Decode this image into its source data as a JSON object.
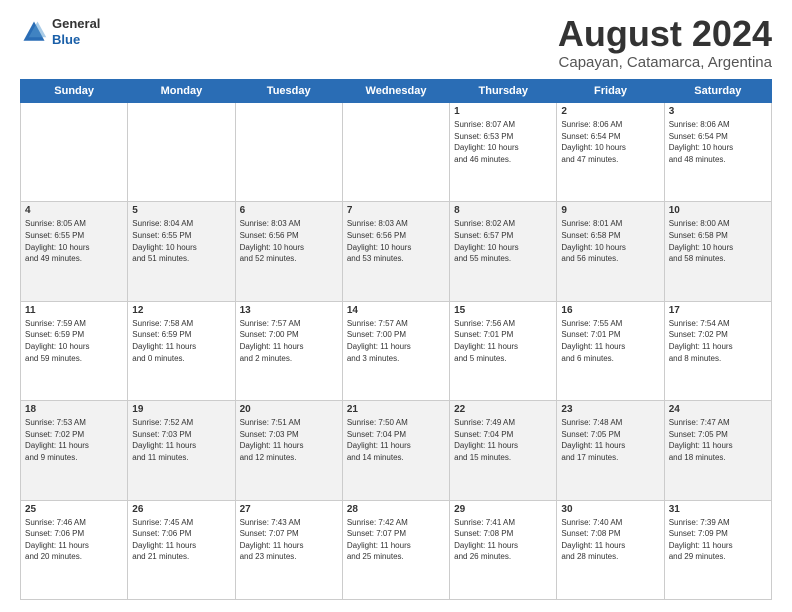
{
  "header": {
    "logo_general": "General",
    "logo_blue": "Blue",
    "title": "August 2024",
    "location": "Capayan, Catamarca, Argentina"
  },
  "days_of_week": [
    "Sunday",
    "Monday",
    "Tuesday",
    "Wednesday",
    "Thursday",
    "Friday",
    "Saturday"
  ],
  "weeks": [
    [
      {
        "day": "",
        "info": ""
      },
      {
        "day": "",
        "info": ""
      },
      {
        "day": "",
        "info": ""
      },
      {
        "day": "",
        "info": ""
      },
      {
        "day": "1",
        "info": "Sunrise: 8:07 AM\nSunset: 6:53 PM\nDaylight: 10 hours\nand 46 minutes."
      },
      {
        "day": "2",
        "info": "Sunrise: 8:06 AM\nSunset: 6:54 PM\nDaylight: 10 hours\nand 47 minutes."
      },
      {
        "day": "3",
        "info": "Sunrise: 8:06 AM\nSunset: 6:54 PM\nDaylight: 10 hours\nand 48 minutes."
      }
    ],
    [
      {
        "day": "4",
        "info": "Sunrise: 8:05 AM\nSunset: 6:55 PM\nDaylight: 10 hours\nand 49 minutes."
      },
      {
        "day": "5",
        "info": "Sunrise: 8:04 AM\nSunset: 6:55 PM\nDaylight: 10 hours\nand 51 minutes."
      },
      {
        "day": "6",
        "info": "Sunrise: 8:03 AM\nSunset: 6:56 PM\nDaylight: 10 hours\nand 52 minutes."
      },
      {
        "day": "7",
        "info": "Sunrise: 8:03 AM\nSunset: 6:56 PM\nDaylight: 10 hours\nand 53 minutes."
      },
      {
        "day": "8",
        "info": "Sunrise: 8:02 AM\nSunset: 6:57 PM\nDaylight: 10 hours\nand 55 minutes."
      },
      {
        "day": "9",
        "info": "Sunrise: 8:01 AM\nSunset: 6:58 PM\nDaylight: 10 hours\nand 56 minutes."
      },
      {
        "day": "10",
        "info": "Sunrise: 8:00 AM\nSunset: 6:58 PM\nDaylight: 10 hours\nand 58 minutes."
      }
    ],
    [
      {
        "day": "11",
        "info": "Sunrise: 7:59 AM\nSunset: 6:59 PM\nDaylight: 10 hours\nand 59 minutes."
      },
      {
        "day": "12",
        "info": "Sunrise: 7:58 AM\nSunset: 6:59 PM\nDaylight: 11 hours\nand 0 minutes."
      },
      {
        "day": "13",
        "info": "Sunrise: 7:57 AM\nSunset: 7:00 PM\nDaylight: 11 hours\nand 2 minutes."
      },
      {
        "day": "14",
        "info": "Sunrise: 7:57 AM\nSunset: 7:00 PM\nDaylight: 11 hours\nand 3 minutes."
      },
      {
        "day": "15",
        "info": "Sunrise: 7:56 AM\nSunset: 7:01 PM\nDaylight: 11 hours\nand 5 minutes."
      },
      {
        "day": "16",
        "info": "Sunrise: 7:55 AM\nSunset: 7:01 PM\nDaylight: 11 hours\nand 6 minutes."
      },
      {
        "day": "17",
        "info": "Sunrise: 7:54 AM\nSunset: 7:02 PM\nDaylight: 11 hours\nand 8 minutes."
      }
    ],
    [
      {
        "day": "18",
        "info": "Sunrise: 7:53 AM\nSunset: 7:02 PM\nDaylight: 11 hours\nand 9 minutes."
      },
      {
        "day": "19",
        "info": "Sunrise: 7:52 AM\nSunset: 7:03 PM\nDaylight: 11 hours\nand 11 minutes."
      },
      {
        "day": "20",
        "info": "Sunrise: 7:51 AM\nSunset: 7:03 PM\nDaylight: 11 hours\nand 12 minutes."
      },
      {
        "day": "21",
        "info": "Sunrise: 7:50 AM\nSunset: 7:04 PM\nDaylight: 11 hours\nand 14 minutes."
      },
      {
        "day": "22",
        "info": "Sunrise: 7:49 AM\nSunset: 7:04 PM\nDaylight: 11 hours\nand 15 minutes."
      },
      {
        "day": "23",
        "info": "Sunrise: 7:48 AM\nSunset: 7:05 PM\nDaylight: 11 hours\nand 17 minutes."
      },
      {
        "day": "24",
        "info": "Sunrise: 7:47 AM\nSunset: 7:05 PM\nDaylight: 11 hours\nand 18 minutes."
      }
    ],
    [
      {
        "day": "25",
        "info": "Sunrise: 7:46 AM\nSunset: 7:06 PM\nDaylight: 11 hours\nand 20 minutes."
      },
      {
        "day": "26",
        "info": "Sunrise: 7:45 AM\nSunset: 7:06 PM\nDaylight: 11 hours\nand 21 minutes."
      },
      {
        "day": "27",
        "info": "Sunrise: 7:43 AM\nSunset: 7:07 PM\nDaylight: 11 hours\nand 23 minutes."
      },
      {
        "day": "28",
        "info": "Sunrise: 7:42 AM\nSunset: 7:07 PM\nDaylight: 11 hours\nand 25 minutes."
      },
      {
        "day": "29",
        "info": "Sunrise: 7:41 AM\nSunset: 7:08 PM\nDaylight: 11 hours\nand 26 minutes."
      },
      {
        "day": "30",
        "info": "Sunrise: 7:40 AM\nSunset: 7:08 PM\nDaylight: 11 hours\nand 28 minutes."
      },
      {
        "day": "31",
        "info": "Sunrise: 7:39 AM\nSunset: 7:09 PM\nDaylight: 11 hours\nand 29 minutes."
      }
    ]
  ]
}
